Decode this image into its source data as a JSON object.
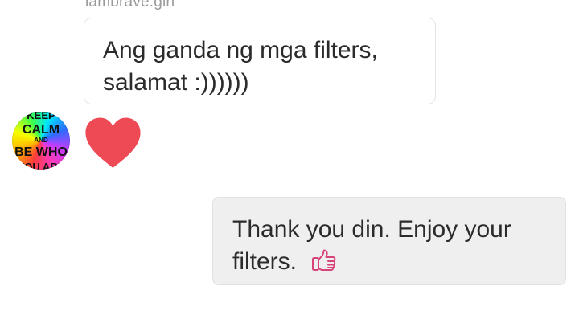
{
  "sender": {
    "username": "iambrave.girl"
  },
  "messages": [
    {
      "direction": "incoming",
      "text_line1": "Ang ganda ng mga filters,",
      "text_line2": "salamat :))))))"
    },
    {
      "direction": "incoming",
      "type": "reaction",
      "icon": "heart-icon",
      "color": "#ee4a55"
    },
    {
      "direction": "outgoing",
      "text_line1": "Thank you din. Enjoy your",
      "text_line2": "filters.",
      "emoji": "thumbs-up-icon",
      "emoji_color": "#d6447a"
    }
  ],
  "avatar": {
    "text_lines": [
      "KEEP",
      "CALM",
      "AND",
      "BE WHO",
      "YOU ARE"
    ]
  },
  "colors": {
    "incoming_bg": "#ffffff",
    "outgoing_bg": "#efefef",
    "text": "#2b2b2b",
    "username": "#9a9a9a"
  }
}
